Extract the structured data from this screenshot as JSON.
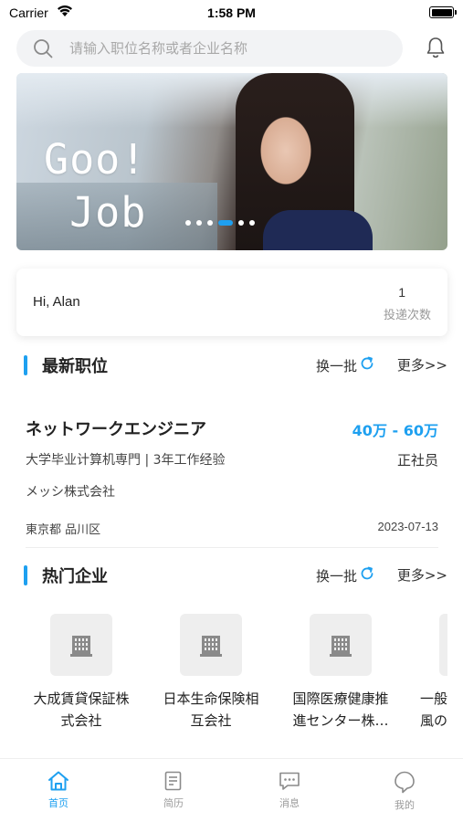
{
  "status_bar": {
    "carrier": "Carrier",
    "time": "1:58 PM"
  },
  "search": {
    "placeholder": "请输入职位名称或者企业名称",
    "icon": "search-icon"
  },
  "header_actions": {
    "notification_icon": "bell-icon"
  },
  "banner": {
    "slogan": "Goo!\n Job",
    "slide_count": 6,
    "active_slide": 4
  },
  "greeting": {
    "text": "Hi, Alan",
    "application_count": "1",
    "application_label": "投递次数"
  },
  "latest_jobs": {
    "title": "最新职位",
    "refresh_label": "换一批",
    "more_label": "更多>>",
    "items": [
      {
        "title": "ネットワークエンジニア",
        "salary": "40万 - 60万",
        "requirements": "大学毕业计算机専門 | 3年工作经验",
        "employment_type": "正社员",
        "company": "メッシ株式会社",
        "location": "東京都 品川区",
        "date": "2023-07-13"
      }
    ]
  },
  "hot_companies": {
    "title": "热门企业",
    "refresh_label": "换一批",
    "more_label": "更多>>",
    "items": [
      {
        "line1": "大成賃貸保証株",
        "line2": "式会社"
      },
      {
        "line1": "日本生命保険相",
        "line2": "互会社"
      },
      {
        "line1": "国際医療健康推",
        "line2": "進センター株…"
      },
      {
        "line1": "一般",
        "line2": "風の"
      }
    ]
  },
  "tabbar": {
    "items": [
      {
        "label": "首页",
        "icon": "home-icon",
        "active": true
      },
      {
        "label": "简历",
        "icon": "resume-icon",
        "active": false
      },
      {
        "label": "消息",
        "icon": "message-icon",
        "active": false
      },
      {
        "label": "我的",
        "icon": "profile-icon",
        "active": false
      }
    ]
  },
  "colors": {
    "accent": "#1ea0f0",
    "text": "#222222",
    "muted": "#999999"
  }
}
